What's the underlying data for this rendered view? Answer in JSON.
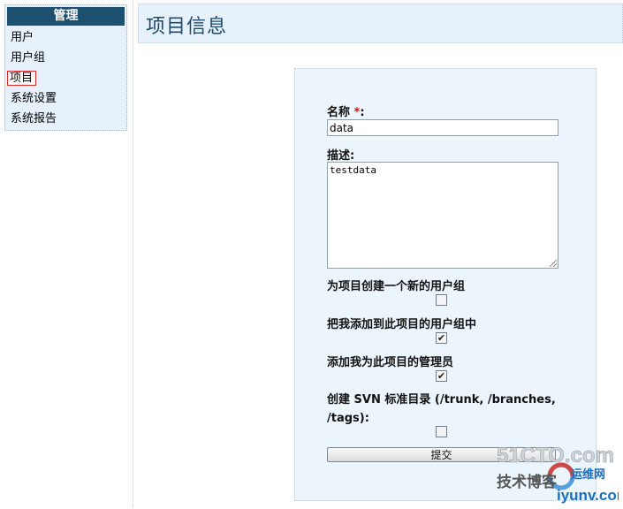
{
  "sidebar": {
    "header": "管理",
    "items": [
      {
        "label": "用户"
      },
      {
        "label": "用户组"
      },
      {
        "label": "项目"
      },
      {
        "label": "系统设置"
      },
      {
        "label": "系统报告"
      }
    ]
  },
  "page": {
    "title": "项目信息"
  },
  "form": {
    "name_label": "名称",
    "required_mark": "*",
    "name_colon": ":",
    "name_value": "data",
    "desc_label": "描述:",
    "desc_value": "testdata",
    "option1_label": "为项目创建一个新的用户组",
    "option1_checked": false,
    "option2_label": "把我添加到此项目的用户组中",
    "option2_checked": true,
    "option3_label": "添加我为此项目的管理员",
    "option3_checked": true,
    "option4_label_line1": "创建 SVN 标准目录 (/trunk, /branches,",
    "option4_label_line2": "/tags):",
    "option4_checked": false,
    "submit_label": "提交"
  },
  "watermark": {
    "site": "51CTO.com",
    "text1": "技术博客",
    "text2": "运维网",
    "url": "iyunv.com"
  },
  "colors": {
    "sidebar_header_bg": "#1d4f6e",
    "panel_bg": "#e6f1fb",
    "active_border": "#d92b2b"
  }
}
